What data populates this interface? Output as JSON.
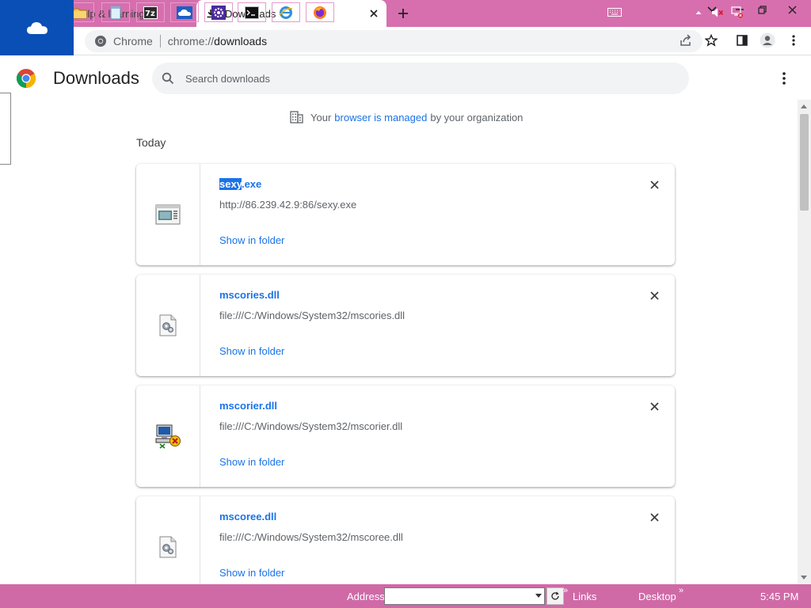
{
  "browser": {
    "tabs": [
      {
        "label": "help & learning",
        "active": false
      },
      {
        "label": "Downloads",
        "active": true
      }
    ],
    "omnibox": {
      "chip_label": "Chrome",
      "url_scheme": "chrome://",
      "url_rest": "downloads"
    }
  },
  "page": {
    "title": "Downloads",
    "search_placeholder": "Search downloads",
    "managed_notice": {
      "before": "Your",
      "link": "browser is managed",
      "after": "by your organization"
    },
    "section_label": "Today"
  },
  "downloads": [
    {
      "name_selected": "sexy",
      "name_rest": ".exe",
      "url": "http://86.239.42.9:86/sexy.exe",
      "action": "Show in folder",
      "icon": "exe-window-icon"
    },
    {
      "name": "mscories.dll",
      "url": "file:///C:/Windows/System32/mscories.dll",
      "action": "Show in folder",
      "icon": "dll-gear-icon"
    },
    {
      "name": "mscorier.dll",
      "url": "file:///C:/Windows/System32/mscorier.dll",
      "action": "Show in folder",
      "icon": "computer-error-icon"
    },
    {
      "name": "mscoree.dll",
      "url": "file:///C:/Windows/System32/mscoree.dll",
      "action": "Show in folder",
      "icon": "dll-gear-icon"
    }
  ],
  "taskbar": {
    "address_label": "Address",
    "links_label": "Links",
    "desktop_label": "Desktop",
    "clock": "5:45 PM"
  },
  "colors": {
    "tab_strip": "#d76fae",
    "onedrive_tile": "#0a4fb5",
    "taskbar": "#cf6aa7",
    "link": "#1a73e8"
  }
}
